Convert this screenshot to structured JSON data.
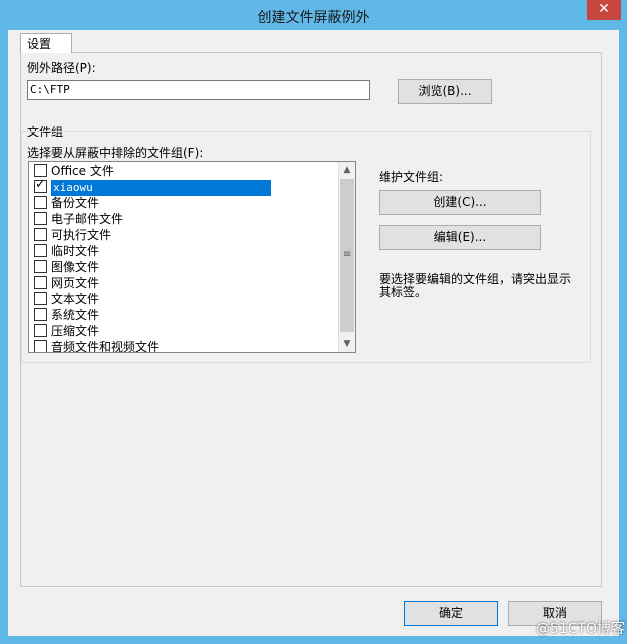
{
  "window": {
    "title": "创建文件屏蔽例外",
    "close_glyph": "✕"
  },
  "tabs": [
    {
      "label": "设置"
    }
  ],
  "exception_path": {
    "label": "例外路径(P):",
    "value": "C:\\FTP",
    "browse_label": "浏览(B)..."
  },
  "file_groups": {
    "group_label": "文件组",
    "select_label": "选择要从屏蔽中排除的文件组(F):",
    "items": [
      {
        "label": "Office 文件",
        "checked": false
      },
      {
        "label": "xiaowu",
        "checked": true,
        "selected": true
      },
      {
        "label": "备份文件",
        "checked": false
      },
      {
        "label": "电子邮件文件",
        "checked": false
      },
      {
        "label": "可执行文件",
        "checked": false
      },
      {
        "label": "临时文件",
        "checked": false
      },
      {
        "label": "图像文件",
        "checked": false
      },
      {
        "label": "网页文件",
        "checked": false
      },
      {
        "label": "文本文件",
        "checked": false
      },
      {
        "label": "系统文件",
        "checked": false
      },
      {
        "label": "压缩文件",
        "checked": false
      },
      {
        "label": "音频文件和视频文件",
        "checked": false
      }
    ],
    "maintain_label": "维护文件组:",
    "create_label": "创建(C)...",
    "edit_label": "编辑(E)...",
    "hint": "要选择要编辑的文件组，请突出显示其标签。"
  },
  "footer": {
    "ok_label": "确定",
    "cancel_label": "取消"
  },
  "watermark": "@51CTO博客"
}
